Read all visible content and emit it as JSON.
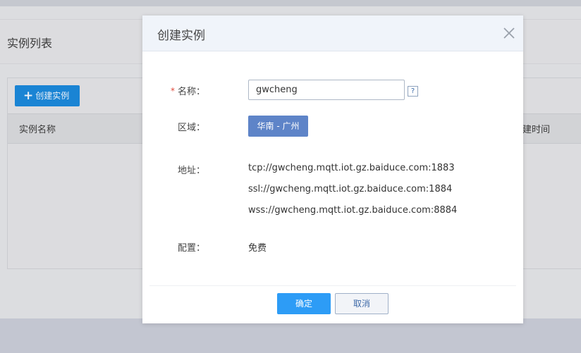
{
  "background_page": {
    "title": "实例列表",
    "create_button": {
      "icon": "plus-icon",
      "label": "创建实例"
    },
    "table": {
      "columns": [
        "实例名称",
        "建时间"
      ]
    }
  },
  "modal": {
    "title": "创建实例",
    "close_icon": "close-icon",
    "form": {
      "name": {
        "required_mark": "*",
        "label": "名称：",
        "value": "gwcheng",
        "help": "?"
      },
      "region": {
        "label": "区域：",
        "value": "华南 - 广州"
      },
      "address": {
        "label": "地址：",
        "lines": [
          "tcp://gwcheng.mqtt.iot.gz.baiduce.com:1883",
          "ssl://gwcheng.mqtt.iot.gz.baiduce.com:1884",
          "wss://gwcheng.mqtt.iot.gz.baiduce.com:8884"
        ]
      },
      "config": {
        "label": "配置：",
        "value": "免费"
      }
    },
    "buttons": {
      "confirm": "确定",
      "cancel": "取消"
    }
  },
  "colors": {
    "primary": "#2d9cf6",
    "region": "#5e84c8",
    "required": "#e04a3b"
  }
}
